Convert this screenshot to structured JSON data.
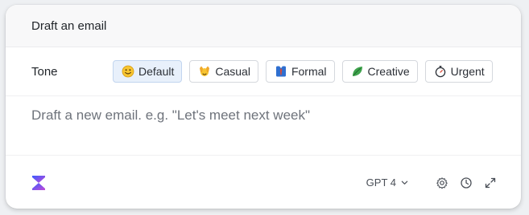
{
  "header": {
    "title": "Draft an email"
  },
  "tone": {
    "label": "Tone",
    "selected": "Default",
    "options": [
      {
        "label": "Default",
        "icon": "smiley-face-icon"
      },
      {
        "label": "Casual",
        "icon": "raised-hands-icon"
      },
      {
        "label": "Formal",
        "icon": "suit-tie-icon"
      },
      {
        "label": "Creative",
        "icon": "leaf-icon"
      },
      {
        "label": "Urgent",
        "icon": "stopwatch-icon"
      }
    ]
  },
  "editor": {
    "placeholder": "Draft a new email. e.g. \"Let's meet next week\""
  },
  "footer": {
    "logo": "app-logo-icon",
    "model_label": "GPT 4",
    "actions": [
      "settings-icon",
      "history-icon",
      "expand-icon"
    ]
  },
  "colors": {
    "selected_chip_bg": "#e8f0fb",
    "logo_gradient_start": "#3b5bff",
    "logo_gradient_end": "#c44bd6"
  }
}
